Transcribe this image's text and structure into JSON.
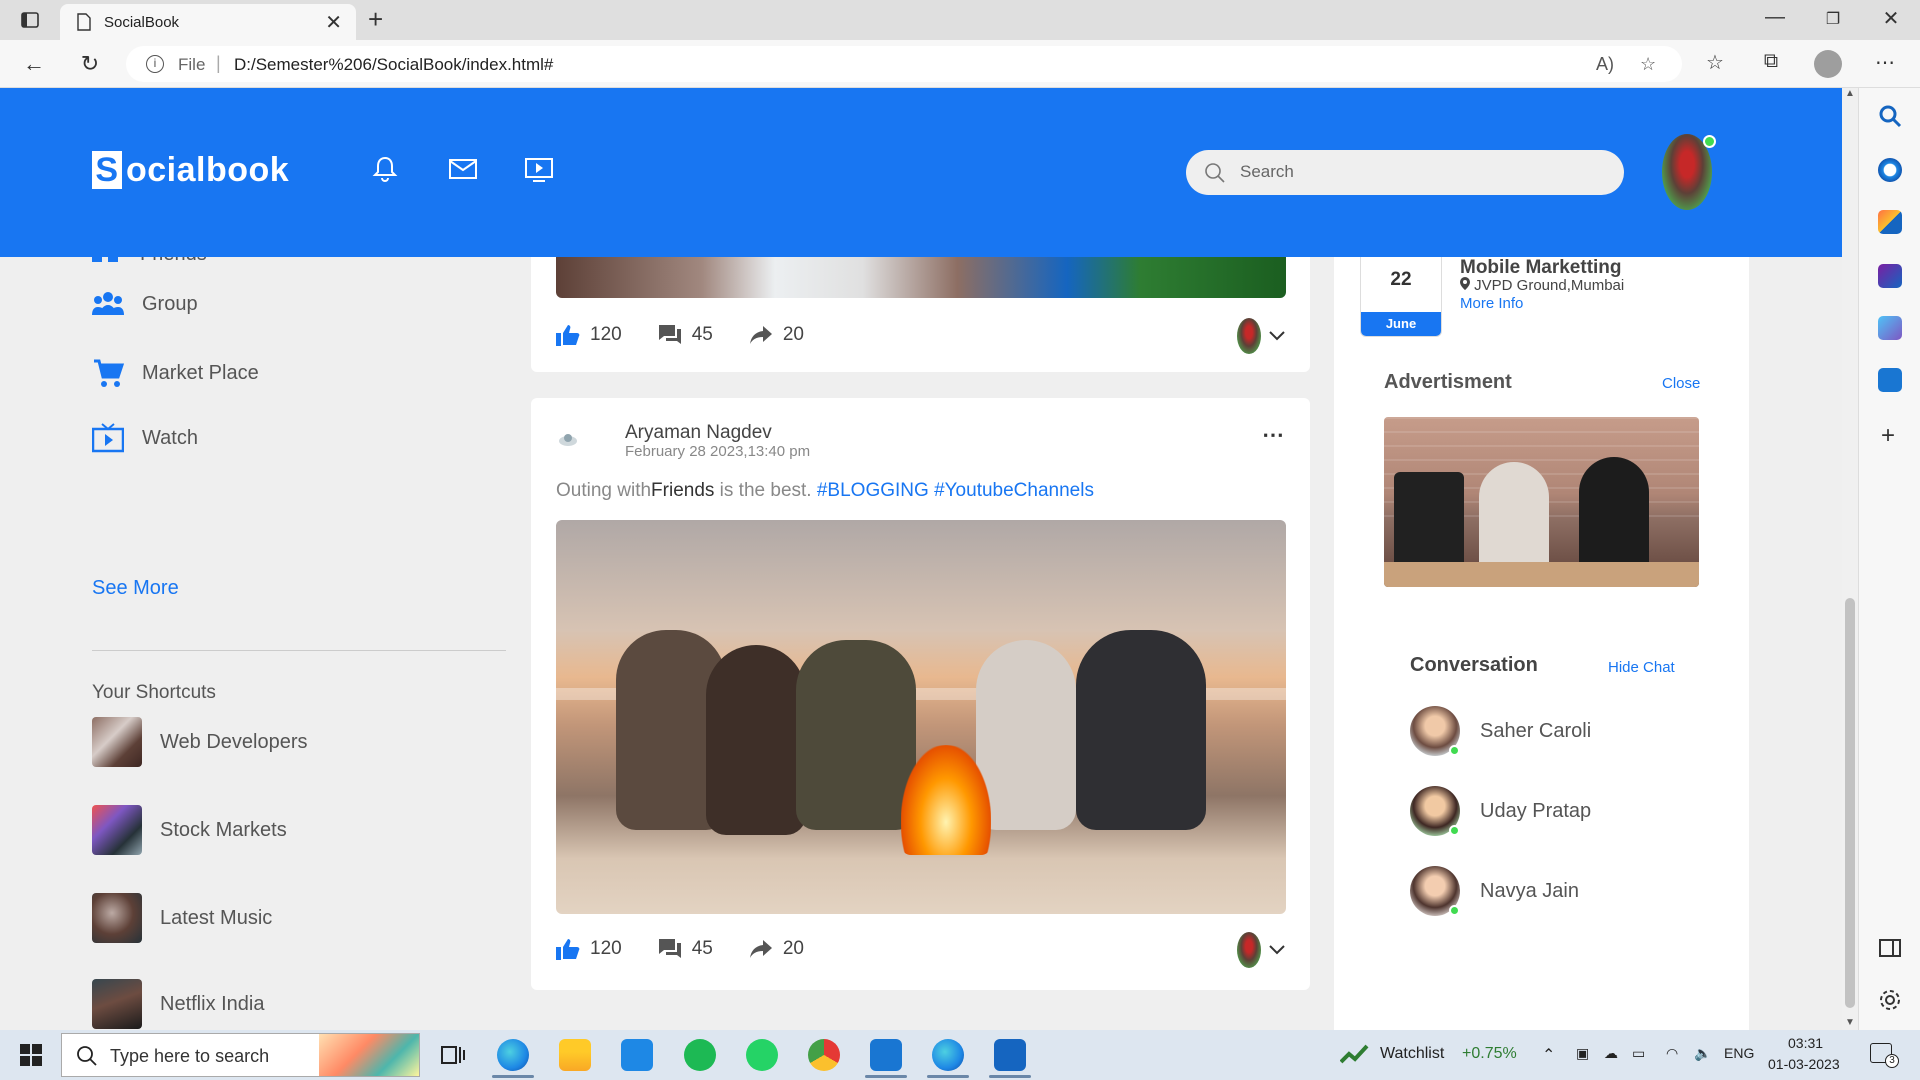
{
  "browser": {
    "tab_title": "SocialBook",
    "address_label": "File",
    "url": "D:/Semester%206/SocialBook/index.html#"
  },
  "site": {
    "logo_text": "ocialbook",
    "logo_letter": "S",
    "search_placeholder": "Search"
  },
  "left_nav": {
    "partial_item": "Friends",
    "items": [
      {
        "label": "Group",
        "icon": "group-icon"
      },
      {
        "label": "Market Place",
        "icon": "cart-icon"
      },
      {
        "label": "Watch",
        "icon": "watch-icon"
      }
    ],
    "see_more": "See More",
    "shortcuts_title": "Your Shortcuts",
    "shortcuts": [
      {
        "label": "Web Developers"
      },
      {
        "label": "Stock Markets"
      },
      {
        "label": "Latest Music"
      },
      {
        "label": "Netflix India"
      }
    ]
  },
  "feed": {
    "post1": {
      "likes": "120",
      "comments": "45",
      "shares": "20"
    },
    "post2": {
      "author": "Aryaman Nagdev",
      "date": "February 28 2023,13:40 pm",
      "text_prefix": "Outing with",
      "text_bold": "Friends",
      "text_suffix": " is the best. ",
      "tag1": "#BLOGGING",
      "tag2": "#YoutubeChannels",
      "likes": "120",
      "comments": "45",
      "shares": "20"
    }
  },
  "right": {
    "event": {
      "day": "22",
      "month": "June",
      "title": "Mobile Marketting",
      "location": "JVPD Ground,Mumbai",
      "more": "More Info"
    },
    "ad_title": "Advertisment",
    "ad_close": "Close",
    "conv_title": "Conversation",
    "conv_hide": "Hide Chat",
    "contacts": [
      {
        "name": "Saher Caroli"
      },
      {
        "name": "Uday Pratap"
      },
      {
        "name": "Navya Jain"
      }
    ]
  },
  "taskbar": {
    "search_placeholder": "Type here to search",
    "watchlist": "Watchlist",
    "watch_change": "+0.75%",
    "lang": "ENG",
    "time": "03:31",
    "date": "01-03-2023",
    "notifications": "3"
  },
  "colors": {
    "brand": "#1876f2",
    "online": "#41db51"
  }
}
